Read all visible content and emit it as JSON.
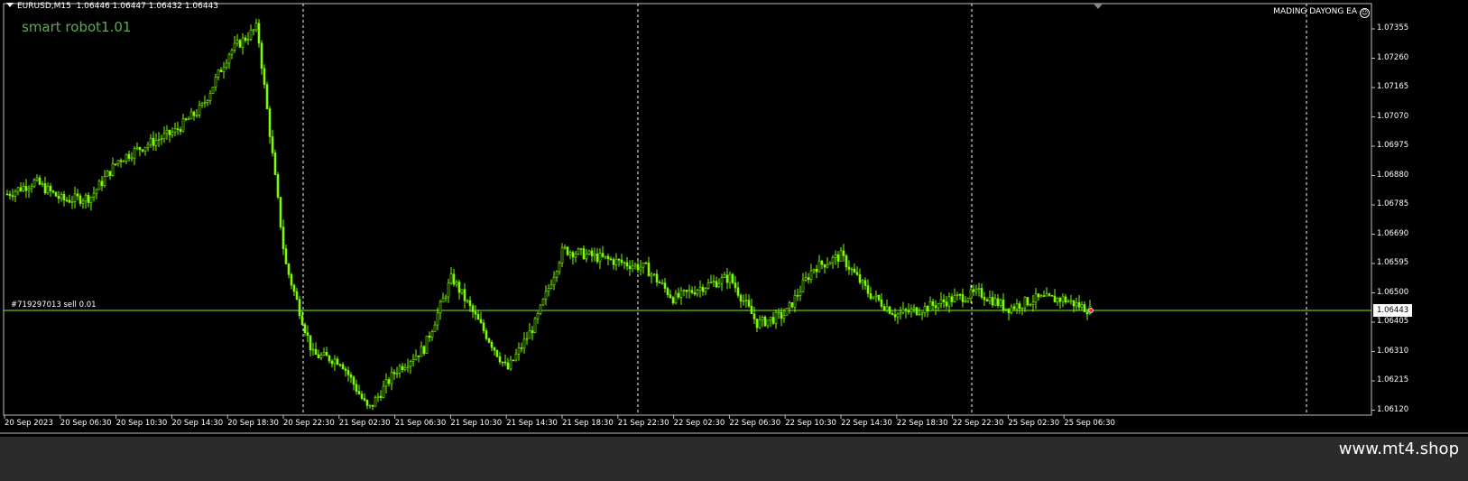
{
  "chart": {
    "symbol": "EURUSD,M15",
    "ohlc": "1.06446 1.06447 1.06432 1.06443",
    "robot_label": "smart robot1.01",
    "ea_label": "MADING DAYONG EA",
    "order_label": "#719297013 sell 0.01",
    "current_price": "1.06443",
    "price_ticks": [
      "1.07355",
      "1.07260",
      "1.07165",
      "1.07070",
      "1.06975",
      "1.06880",
      "1.06785",
      "1.06690",
      "1.06595",
      "1.06500",
      "1.06405",
      "1.06310",
      "1.06215",
      "1.06120"
    ],
    "time_ticks": [
      "20 Sep 2023",
      "20 Sep 06:30",
      "20 Sep 10:30",
      "20 Sep 14:30",
      "20 Sep 18:30",
      "20 Sep 22:30",
      "21 Sep 02:30",
      "21 Sep 06:30",
      "21 Sep 10:30",
      "21 Sep 14:30",
      "21 Sep 18:30",
      "21 Sep 22:30",
      "22 Sep 02:30",
      "22 Sep 06:30",
      "22 Sep 10:30",
      "22 Sep 14:30",
      "22 Sep 18:30",
      "22 Sep 22:30",
      "25 Sep 02:30",
      "25 Sep 06:30"
    ],
    "day_separators": [
      "21 Sep 00:00",
      "22 Sep 00:00",
      "25 Sep 00:00",
      "26 Sep 00:00"
    ],
    "candle_color": "#7cfc00",
    "grid_color": "#ffffff",
    "order_line_color": "#7cfc00"
  },
  "chart_data": {
    "type": "line",
    "title": "EURUSD,M15",
    "ylim": [
      1.061,
      1.0741
    ],
    "x": [
      "20 Sep 02:30",
      "20 Sep 04:30",
      "20 Sep 06:30",
      "20 Sep 08:30",
      "20 Sep 10:30",
      "20 Sep 12:30",
      "20 Sep 14:30",
      "20 Sep 16:30",
      "20 Sep 18:30",
      "20 Sep 20:30",
      "20 Sep 22:30",
      "21 Sep 00:30",
      "21 Sep 02:30",
      "21 Sep 04:30",
      "21 Sep 06:30",
      "21 Sep 08:30",
      "21 Sep 10:30",
      "21 Sep 12:30",
      "21 Sep 14:30",
      "21 Sep 16:30",
      "21 Sep 18:30",
      "21 Sep 20:30",
      "21 Sep 22:30",
      "22 Sep 00:30",
      "22 Sep 02:30",
      "22 Sep 04:30",
      "22 Sep 06:30",
      "22 Sep 08:30",
      "22 Sep 10:30",
      "22 Sep 12:30",
      "22 Sep 14:30",
      "22 Sep 16:30",
      "22 Sep 18:30",
      "22 Sep 20:30",
      "22 Sep 22:30",
      "25 Sep 00:30",
      "25 Sep 02:30",
      "25 Sep 04:30",
      "25 Sep 06:30",
      "25 Sep 07:45"
    ],
    "series": [
      {
        "values": [
          1.0682,
          1.0686,
          1.068,
          1.0681,
          1.0693,
          1.0698,
          1.0702,
          1.071,
          1.0728,
          1.0736,
          1.066,
          1.063,
          1.0628,
          1.0612,
          1.0625,
          1.0632,
          1.0655,
          1.064,
          1.0625,
          1.064,
          1.0664,
          1.0662,
          1.066,
          1.0658,
          1.0648,
          1.0652,
          1.0655,
          1.064,
          1.0643,
          1.0658,
          1.0662,
          1.065,
          1.0643,
          1.0645,
          1.0648,
          1.065,
          1.0645,
          1.0648,
          1.0648,
          1.06443
        ]
      }
    ]
  },
  "footer": {
    "watermark": "www.mt4.shop"
  }
}
